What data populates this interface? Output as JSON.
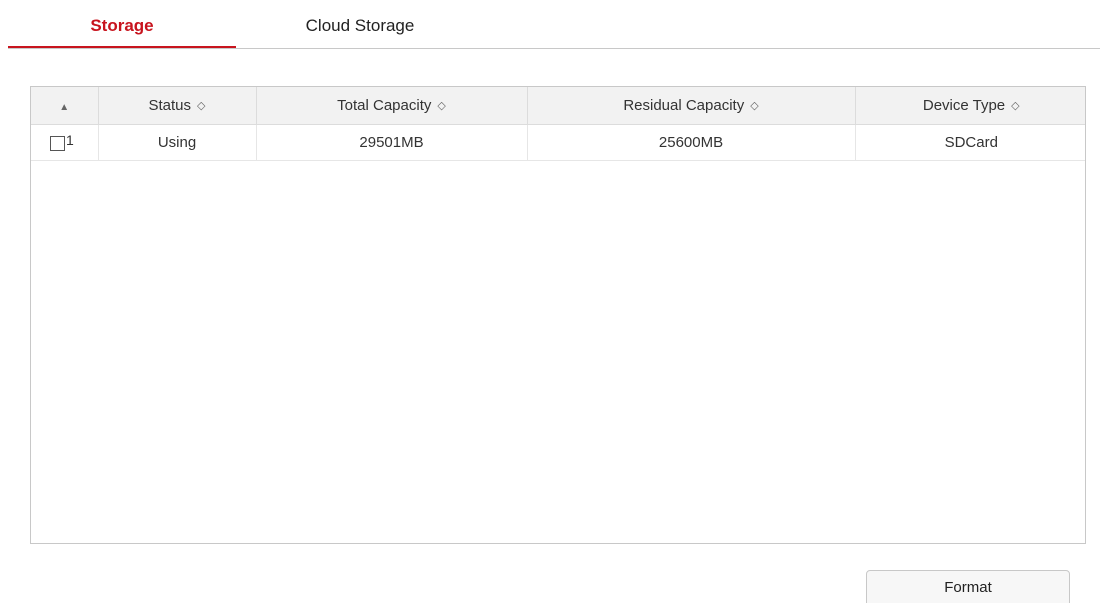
{
  "tabs": [
    {
      "label": "Storage",
      "active": true
    },
    {
      "label": "Cloud Storage",
      "active": false
    }
  ],
  "table": {
    "headers": {
      "index_sort": "▲",
      "status": "Status",
      "total_capacity": "Total Capacity",
      "residual_capacity": "Residual Capacity",
      "device_type": "Device Type",
      "sort_glyph": "◇"
    },
    "rows": [
      {
        "index": "1",
        "checked": false,
        "status": "Using",
        "total_capacity": "29501MB",
        "residual_capacity": "25600MB",
        "device_type": "SDCard"
      }
    ]
  },
  "actions": {
    "format_label": "Format"
  },
  "colors": {
    "accent": "#c8141e",
    "border": "#c8c8c8",
    "header_bg": "#f2f2f2"
  }
}
